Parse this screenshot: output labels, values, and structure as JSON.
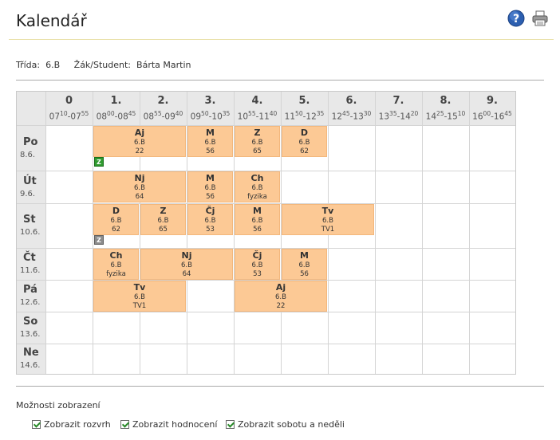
{
  "page": {
    "title": "Kalendář",
    "class_label": "Třída:",
    "class_value": "6.B",
    "student_label": "Žák/Student:",
    "student_value": "Bárta Martin"
  },
  "icons": {
    "help": "help-icon",
    "print": "printer-icon"
  },
  "columns": [
    {
      "num": "0",
      "start_h": "07",
      "start_m": "10",
      "end_h": "07",
      "end_m": "55"
    },
    {
      "num": "1.",
      "start_h": "08",
      "start_m": "00",
      "end_h": "08",
      "end_m": "45"
    },
    {
      "num": "2.",
      "start_h": "08",
      "start_m": "55",
      "end_h": "09",
      "end_m": "40"
    },
    {
      "num": "3.",
      "start_h": "09",
      "start_m": "50",
      "end_h": "10",
      "end_m": "35"
    },
    {
      "num": "4.",
      "start_h": "10",
      "start_m": "55",
      "end_h": "11",
      "end_m": "40"
    },
    {
      "num": "5.",
      "start_h": "11",
      "start_m": "50",
      "end_h": "12",
      "end_m": "35"
    },
    {
      "num": "6.",
      "start_h": "12",
      "start_m": "45",
      "end_h": "13",
      "end_m": "30"
    },
    {
      "num": "7.",
      "start_h": "13",
      "start_m": "35",
      "end_h": "14",
      "end_m": "20"
    },
    {
      "num": "8.",
      "start_h": "14",
      "start_m": "25",
      "end_h": "15",
      "end_m": "10"
    },
    {
      "num": "9.",
      "start_h": "16",
      "start_m": "00",
      "end_h": "16",
      "end_m": "45"
    }
  ],
  "days": [
    {
      "name": "Po",
      "date": "8.6.",
      "lessons": [
        {
          "start": 1,
          "span": 2,
          "subject": "Aj",
          "class": "6.B",
          "room": "22"
        },
        {
          "start": 3,
          "span": 1,
          "subject": "M",
          "class": "6.B",
          "room": "56"
        },
        {
          "start": 4,
          "span": 1,
          "subject": "Z",
          "class": "6.B",
          "room": "65"
        },
        {
          "start": 5,
          "span": 1,
          "subject": "D",
          "class": "6.B",
          "room": "62"
        }
      ],
      "badges": [
        {
          "col": 1,
          "text": "Z",
          "color": "green"
        }
      ]
    },
    {
      "name": "Út",
      "date": "9.6.",
      "lessons": [
        {
          "start": 1,
          "span": 2,
          "subject": "Nj",
          "class": "6.B",
          "room": "64"
        },
        {
          "start": 3,
          "span": 1,
          "subject": "M",
          "class": "6.B",
          "room": "56"
        },
        {
          "start": 4,
          "span": 1,
          "subject": "Ch",
          "class": "6.B",
          "room": "fyzika"
        }
      ],
      "badges": []
    },
    {
      "name": "St",
      "date": "10.6.",
      "lessons": [
        {
          "start": 1,
          "span": 1,
          "subject": "D",
          "class": "6.B",
          "room": "62"
        },
        {
          "start": 2,
          "span": 1,
          "subject": "Z",
          "class": "6.B",
          "room": "65"
        },
        {
          "start": 3,
          "span": 1,
          "subject": "Čj",
          "class": "6.B",
          "room": "53"
        },
        {
          "start": 4,
          "span": 1,
          "subject": "M",
          "class": "6.B",
          "room": "56"
        },
        {
          "start": 5,
          "span": 2,
          "subject": "Tv",
          "class": "6.B",
          "room": "TV1"
        }
      ],
      "badges": [
        {
          "col": 1,
          "text": "Z",
          "color": "gray"
        }
      ]
    },
    {
      "name": "Čt",
      "date": "11.6.",
      "lessons": [
        {
          "start": 1,
          "span": 1,
          "subject": "Ch",
          "class": "6.B",
          "room": "fyzika"
        },
        {
          "start": 2,
          "span": 2,
          "subject": "Nj",
          "class": "6.B",
          "room": "64"
        },
        {
          "start": 4,
          "span": 1,
          "subject": "Čj",
          "class": "6.B",
          "room": "53"
        },
        {
          "start": 5,
          "span": 1,
          "subject": "M",
          "class": "6.B",
          "room": "56"
        }
      ],
      "badges": []
    },
    {
      "name": "Pá",
      "date": "12.6.",
      "lessons": [
        {
          "start": 1,
          "span": 2,
          "subject": "Tv",
          "class": "6.B",
          "room": "TV1"
        },
        {
          "start": 4,
          "span": 2,
          "subject": "Aj",
          "class": "6.B",
          "room": "22"
        }
      ],
      "badges": []
    },
    {
      "name": "So",
      "date": "13.6.",
      "lessons": [],
      "badges": []
    },
    {
      "name": "Ne",
      "date": "14.6.",
      "lessons": [],
      "badges": []
    }
  ],
  "options": {
    "title": "Možnosti zobrazení",
    "items": [
      {
        "label": "Zobrazit rozvrh",
        "checked": true
      },
      {
        "label": "Zobrazit hodnocení",
        "checked": true
      },
      {
        "label": "Zobrazit sobotu a neděli",
        "checked": true
      }
    ]
  },
  "colors": {
    "lesson": "#fcc995",
    "header": "#e8e8e8",
    "badge_green": "#2e9a2e",
    "badge_gray": "#8a8a8a"
  }
}
